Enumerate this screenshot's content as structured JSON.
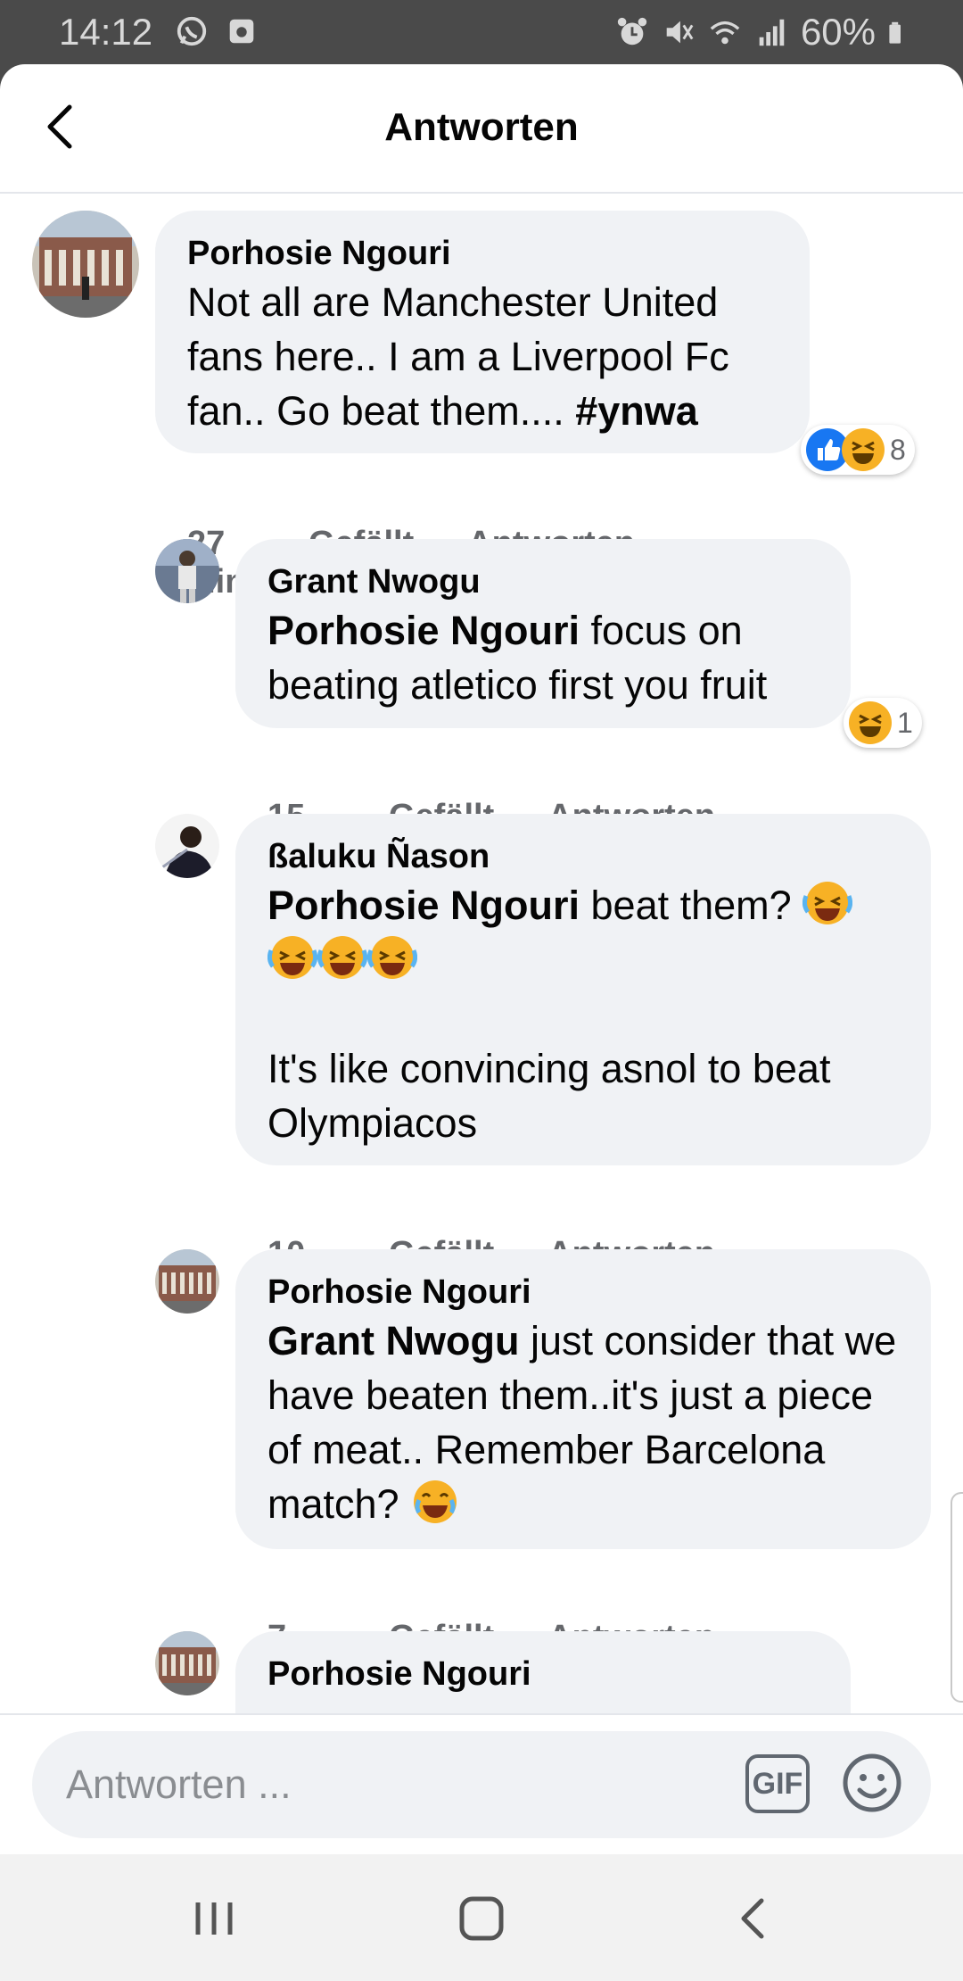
{
  "status_bar": {
    "time": "14:12",
    "battery": "60%",
    "icons": [
      "whatsapp-icon",
      "screenshot-icon",
      "alarm-icon",
      "mute-icon",
      "wifi-icon",
      "signal-icon",
      "battery-icon"
    ]
  },
  "header": {
    "title": "Antworten"
  },
  "comments": [
    {
      "author": "Porhosie Ngouri",
      "text_before": "Not all are Manchester United fans here.. I am a Liverpool Fc fan.. Go beat them.... ",
      "hashtag": "#ynwa",
      "time": "27 Min.",
      "like_label": "Gefällt mir",
      "reply_label": "Antworten",
      "reaction_count": "8",
      "reactions": [
        "like",
        "haha"
      ]
    },
    {
      "author": "Grant Nwogu",
      "mention": "Porhosie Ngouri",
      "text": " focus on beating atletico first you fruit",
      "time": "15 Min.",
      "like_label": "Gefällt mir",
      "reply_label": "Antworten",
      "reaction_count": "1",
      "reactions": [
        "haha"
      ]
    },
    {
      "author": "ßaluku Ñason",
      "mention": "Porhosie Ngouri",
      "text": "  beat them?",
      "text_2": "It's like convincing asnol to beat Olympiacos",
      "emoji": "rofl",
      "time": "10 Min.",
      "like_label": "Gefällt mir",
      "reply_label": "Antworten"
    },
    {
      "author": "Porhosie Ngouri",
      "mention": "Grant Nwogu",
      "text": " just consider that we have beaten them..it's just a piece of meat..  Remember Barcelona match? ",
      "emoji": "joy",
      "time": "7 Min.",
      "like_label": "Gefällt mir",
      "reply_label": "Antworten"
    },
    {
      "author": "Porhosie Ngouri"
    }
  ],
  "composer": {
    "placeholder": "Antworten ...",
    "gif_label": "GIF"
  },
  "colors": {
    "bubble": "#f0f2f5",
    "meta_text": "#65676b",
    "like_blue": "#1877f2",
    "haha_yellow": "#f7b125"
  }
}
